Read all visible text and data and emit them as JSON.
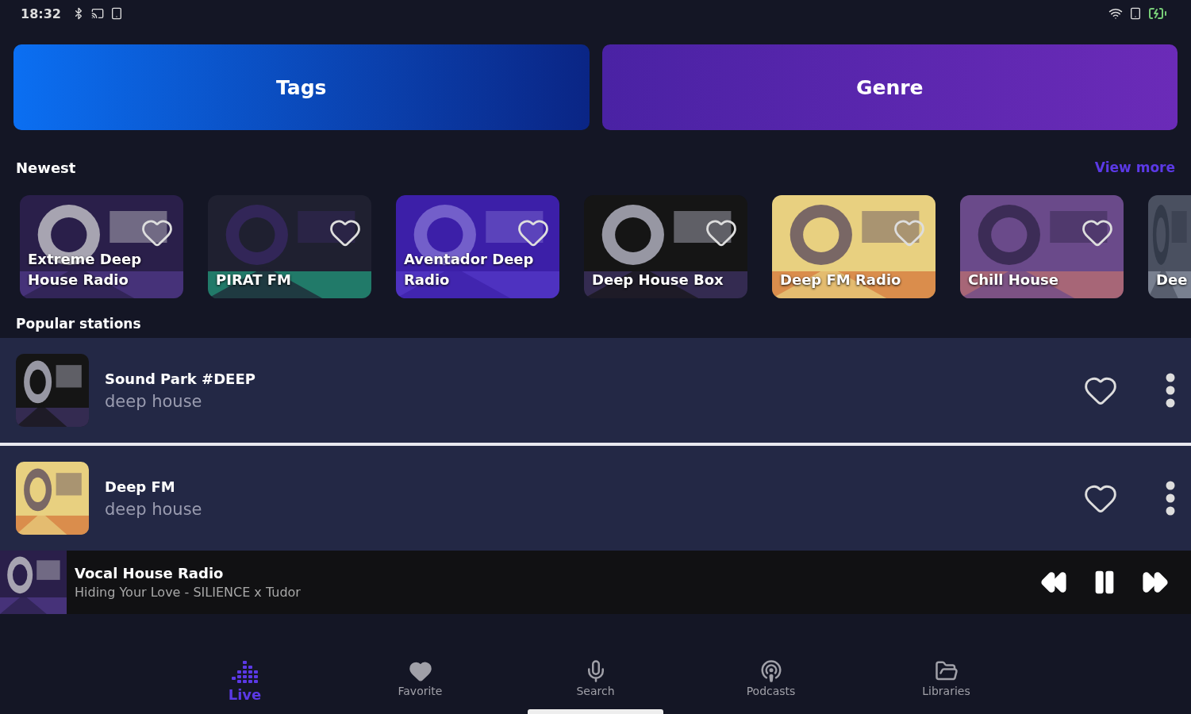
{
  "status_bar": {
    "time": "18:32"
  },
  "category_buttons": [
    {
      "label": "Tags",
      "kind": "tags"
    },
    {
      "label": "Genre",
      "kind": "genre"
    }
  ],
  "newest": {
    "title": "Newest",
    "view_more": "View more",
    "stations": [
      {
        "name": "Extreme Deep House Radio",
        "favorite": false,
        "kind": "picture"
      },
      {
        "name": "PIRAT FM",
        "favorite": false,
        "kind": "picture"
      },
      {
        "name": "Aventador Deep Radio",
        "favorite": false,
        "kind": "picture"
      },
      {
        "name": "Deep House Box",
        "favorite": false,
        "kind": "picture"
      },
      {
        "name": "Deep FM Radio",
        "favorite": false,
        "kind": "picture"
      },
      {
        "name": "Chill House",
        "favorite": false,
        "kind": "picture"
      },
      {
        "name": "Dee",
        "kind": "picture"
      }
    ]
  },
  "popular": {
    "title": "Popular stations",
    "stations": [
      {
        "name": "Sound Park #DEEP",
        "genre": "deep house",
        "favorite": false
      },
      {
        "name": "Deep FM",
        "genre": "deep house",
        "favorite": false
      }
    ]
  },
  "player": {
    "station": "Vocal House Radio",
    "track": "Hiding Your Love - SILIENCE x Tudor",
    "playing": true
  },
  "nav": [
    {
      "label": "Live",
      "selected": true
    },
    {
      "label": "Favorite",
      "selected": false
    },
    {
      "label": "Search",
      "selected": false
    },
    {
      "label": "Podcasts",
      "selected": false
    },
    {
      "label": "Libraries",
      "selected": false
    }
  ]
}
